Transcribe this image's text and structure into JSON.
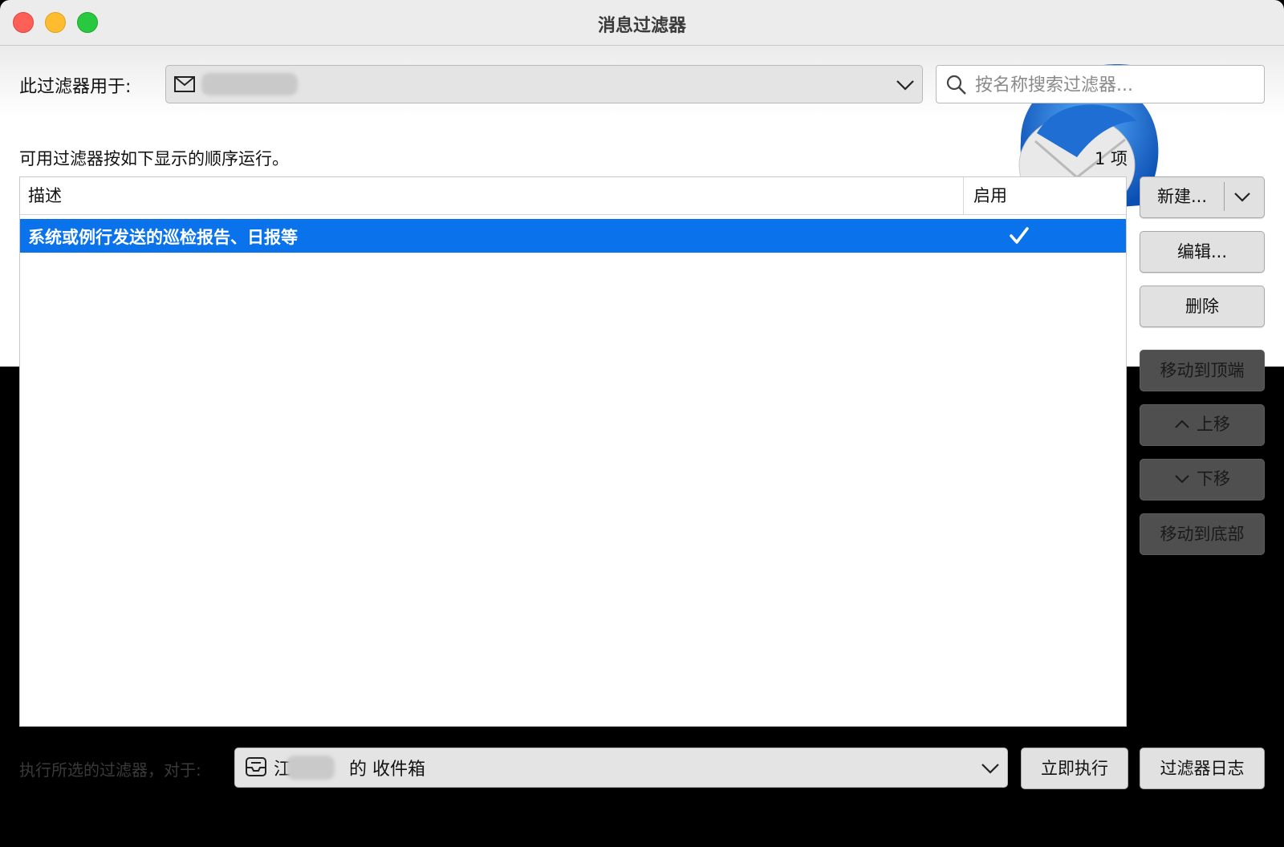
{
  "window": {
    "title": "消息过滤器"
  },
  "header": {
    "apply_label": "此过滤器用于:",
    "account_text": "",
    "search_placeholder": "按名称搜索过滤器...",
    "order_note": "可用过滤器按如下显示的顺序运行。",
    "count": "1 项"
  },
  "table": {
    "columns": [
      "描述",
      "启用"
    ],
    "rows": [
      {
        "description": "系统或例行发送的巡检报告、日报等",
        "enabled": true
      }
    ]
  },
  "side_buttons": {
    "new": "新建...",
    "edit": "编辑...",
    "delete": "删除",
    "move_top": "移动到顶端",
    "move_up": "上移",
    "move_down": "下移",
    "move_bottom": "移动到底部"
  },
  "footer": {
    "run_label": "执行所选的过滤器，对于:",
    "folder_prefix": "江",
    "folder_suffix": "的 收件箱",
    "run_now": "立即执行",
    "filter_log": "过滤器日志"
  },
  "colors": {
    "selection": "#0a73ec",
    "close": "#fe5f57",
    "minimize": "#febc2e",
    "maximize": "#28c840"
  },
  "icons": [
    "search-icon",
    "mail-account-icon",
    "inbox-folder-icon",
    "chevron-down-icon",
    "chevron-up-icon",
    "checkmark-icon",
    "thunderbird-logo"
  ]
}
